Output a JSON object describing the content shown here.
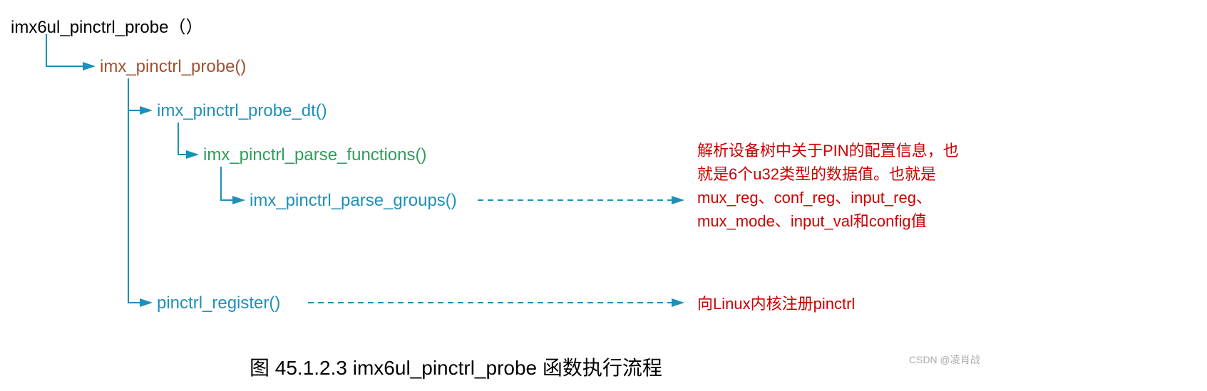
{
  "tree": {
    "root": "imx6ul_pinctrl_probe（）",
    "n1": "imx_pinctrl_probe()",
    "n2": "imx_pinctrl_probe_dt()",
    "n3": "imx_pinctrl_parse_functions()",
    "n4": "imx_pinctrl_parse_groups()",
    "n5": "pinctrl_register()"
  },
  "annotations": {
    "a1": "解析设备树中关于PIN的配置信息，也就是6个u32类型的数据值。也就是mux_reg、conf_reg、input_reg、mux_mode、input_val和config值",
    "a2": "向Linux内核注册pinctrl"
  },
  "caption": "图 45.1.2.3 imx6ul_pinctrl_probe 函数执行流程",
  "watermark": "CSDN @凌肖战",
  "chart_data": {
    "type": "tree",
    "title": "图 45.1.2.3 imx6ul_pinctrl_probe 函数执行流程",
    "nodes": [
      {
        "id": "root",
        "label": "imx6ul_pinctrl_probe（）",
        "level": 0
      },
      {
        "id": "n1",
        "label": "imx_pinctrl_probe()",
        "level": 1,
        "parent": "root"
      },
      {
        "id": "n2",
        "label": "imx_pinctrl_probe_dt()",
        "level": 2,
        "parent": "n1"
      },
      {
        "id": "n3",
        "label": "imx_pinctrl_parse_functions()",
        "level": 3,
        "parent": "n2"
      },
      {
        "id": "n4",
        "label": "imx_pinctrl_parse_groups()",
        "level": 4,
        "parent": "n3",
        "annotation": "解析设备树中关于PIN的配置信息，也就是6个u32类型的数据值。也就是mux_reg、conf_reg、input_reg、mux_mode、input_val和config值"
      },
      {
        "id": "n5",
        "label": "pinctrl_register()",
        "level": 2,
        "parent": "n1",
        "annotation": "向Linux内核注册pinctrl"
      }
    ]
  }
}
